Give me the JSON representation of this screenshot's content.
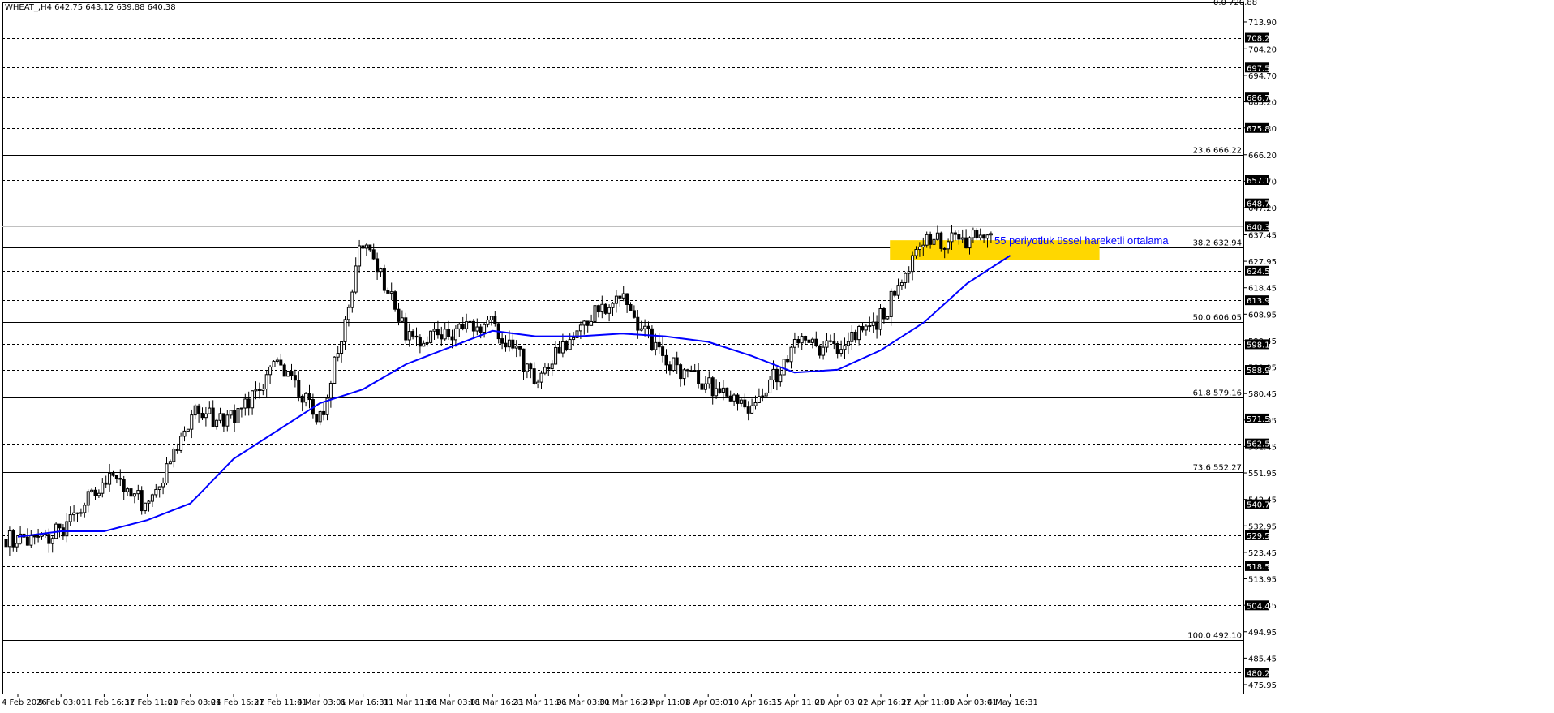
{
  "header": {
    "symbol_line": "WHEAT_,H4  642.75 643.12 639.88 640.38"
  },
  "top_label": "0.0 720.88",
  "annotation": "55 periyotluk üssel hareketli ortalama",
  "colors": {
    "candle": "#000000",
    "ema": "#0000ff",
    "highlight_zone": "#ffd700",
    "tag_bg": "#000000",
    "tag_text": "#ffffff",
    "background": "#ffffff"
  },
  "chart_data": {
    "type": "line",
    "title": "",
    "xlabel": "",
    "ylabel": "",
    "ylim": [
      475.9,
      723.5
    ],
    "grid": false,
    "x_tick_labels": [
      "4 Feb 2026",
      "9 Feb 03:01",
      "11 Feb 16:31",
      "17 Feb 11:01",
      "20 Feb 03:01",
      "24 Feb 16:31",
      "27 Feb 11:01",
      "4 Mar 03:01",
      "6 Mar 16:31",
      "11 Mar 11:01",
      "16 Mar 03:01",
      "18 Mar 16:31",
      "23 Mar 11:01",
      "26 Mar 03:01",
      "30 Mar 16:31",
      "2 Apr 11:01",
      "8 Apr 03:01",
      "10 Apr 16:31",
      "15 Apr 11:01",
      "20 Apr 03:01",
      "22 Apr 16:31",
      "27 Apr 11:01",
      "30 Apr 03:01",
      "4 May 16:31"
    ],
    "y_axis_ticks": [
      "713.90",
      "704.20",
      "694.70",
      "685.20",
      "675.80",
      "666.20",
      "656.70",
      "647.20",
      "637.45",
      "627.95",
      "618.45",
      "608.95",
      "599.45",
      "589.95",
      "580.45",
      "570.95",
      "561.45",
      "551.95",
      "542.45",
      "532.95",
      "523.45",
      "513.95",
      "504.45",
      "494.95",
      "485.45",
      "475.95"
    ],
    "horizontal_levels": [
      {
        "value": 708.2,
        "label": "708.20"
      },
      {
        "value": 697.5,
        "label": "697.50"
      },
      {
        "value": 686.75,
        "label": "686.75"
      },
      {
        "value": 675.8,
        "label": "675.80"
      },
      {
        "value": 657.1,
        "label": "657.10"
      },
      {
        "value": 648.75,
        "label": "648.75"
      },
      {
        "value": 624.55,
        "label": "624.55"
      },
      {
        "value": 613.95,
        "label": "613.95"
      },
      {
        "value": 598.15,
        "label": "598.15"
      },
      {
        "value": 588.95,
        "label": "588.95"
      },
      {
        "value": 571.5,
        "label": "571.50"
      },
      {
        "value": 562.55,
        "label": "562.55"
      },
      {
        "value": 540.7,
        "label": "540.70"
      },
      {
        "value": 529.55,
        "label": "529.55"
      },
      {
        "value": 518.5,
        "label": "518.50"
      },
      {
        "value": 504.4,
        "label": "504.40"
      },
      {
        "value": 480.2,
        "label": "480.20"
      }
    ],
    "current_price": {
      "value": 640.38,
      "label": "640.38"
    },
    "fibonacci_levels": [
      {
        "value": 666.22,
        "label": "23.6 666.22"
      },
      {
        "value": 632.94,
        "label": "38.2 632.94"
      },
      {
        "value": 606.05,
        "label": "50.0 606.05"
      },
      {
        "value": 579.16,
        "label": "61.8 579.16"
      },
      {
        "value": 552.27,
        "label": "73.6 552.27"
      },
      {
        "value": 492.1,
        "label": "100.0 492.10"
      }
    ],
    "highlight_zone": {
      "x_from": "27 Apr 11:01",
      "x_to": "4 May 16:31",
      "y_low": 628.5,
      "y_high": 635.5
    },
    "series": [
      {
        "name": "WHEAT_,H4",
        "kind": "candlestick",
        "keypoints": [
          {
            "x": "4 Feb 2026",
            "close": 528
          },
          {
            "x": "9 Feb 03:01",
            "close": 531
          },
          {
            "x": "11 Feb 16:31",
            "close": 551
          },
          {
            "x": "17 Feb 11:01",
            "close": 540
          },
          {
            "x": "20 Feb 03:01",
            "close": 573
          },
          {
            "x": "24 Feb 16:31",
            "close": 571
          },
          {
            "x": "27 Feb 11:01",
            "close": 592
          },
          {
            "x": "4 Mar 03:01",
            "close": 570
          },
          {
            "x": "6 Mar 16:31",
            "close": 638
          },
          {
            "x": "11 Mar 11:01",
            "close": 600
          },
          {
            "x": "16 Mar 03:01",
            "close": 603
          },
          {
            "x": "18 Mar 16:31",
            "close": 606
          },
          {
            "x": "23 Mar 11:01",
            "close": 585
          },
          {
            "x": "26 Mar 03:01",
            "close": 606
          },
          {
            "x": "30 Mar 16:31",
            "close": 614
          },
          {
            "x": "2 Apr 11:01",
            "close": 592
          },
          {
            "x": "8 Apr 03:01",
            "close": 583
          },
          {
            "x": "10 Apr 16:31",
            "close": 575
          },
          {
            "x": "15 Apr 11:01",
            "close": 598
          },
          {
            "x": "20 Apr 03:01",
            "close": 597
          },
          {
            "x": "22 Apr 16:31",
            "close": 608
          },
          {
            "x": "27 Apr 11:01",
            "close": 635
          },
          {
            "x": "30 Apr 03:01",
            "close": 636
          },
          {
            "x": "4 May 16:31",
            "close": 640.38
          }
        ]
      },
      {
        "name": "55 periyotluk üssel hareketli ortalama",
        "kind": "line",
        "values": [
          {
            "x": "4 Feb 2026",
            "y": 529
          },
          {
            "x": "9 Feb 03:01",
            "y": 531
          },
          {
            "x": "11 Feb 16:31",
            "y": 531
          },
          {
            "x": "17 Feb 11:01",
            "y": 535
          },
          {
            "x": "20 Feb 03:01",
            "y": 541
          },
          {
            "x": "24 Feb 16:31",
            "y": 557
          },
          {
            "x": "27 Feb 11:01",
            "y": 567
          },
          {
            "x": "4 Mar 03:01",
            "y": 577
          },
          {
            "x": "6 Mar 16:31",
            "y": 582
          },
          {
            "x": "11 Mar 11:01",
            "y": 591
          },
          {
            "x": "16 Mar 03:01",
            "y": 597
          },
          {
            "x": "18 Mar 16:31",
            "y": 603
          },
          {
            "x": "23 Mar 11:01",
            "y": 601
          },
          {
            "x": "26 Mar 03:01",
            "y": 601
          },
          {
            "x": "30 Mar 16:31",
            "y": 602
          },
          {
            "x": "2 Apr 11:01",
            "y": 601
          },
          {
            "x": "8 Apr 03:01",
            "y": 599
          },
          {
            "x": "10 Apr 16:31",
            "y": 594
          },
          {
            "x": "15 Apr 11:01",
            "y": 588
          },
          {
            "x": "20 Apr 03:01",
            "y": 589
          },
          {
            "x": "22 Apr 16:31",
            "y": 596
          },
          {
            "x": "27 Apr 11:01",
            "y": 606
          },
          {
            "x": "30 Apr 03:01",
            "y": 620
          },
          {
            "x": "4 May 16:31",
            "y": 630
          }
        ]
      }
    ]
  }
}
